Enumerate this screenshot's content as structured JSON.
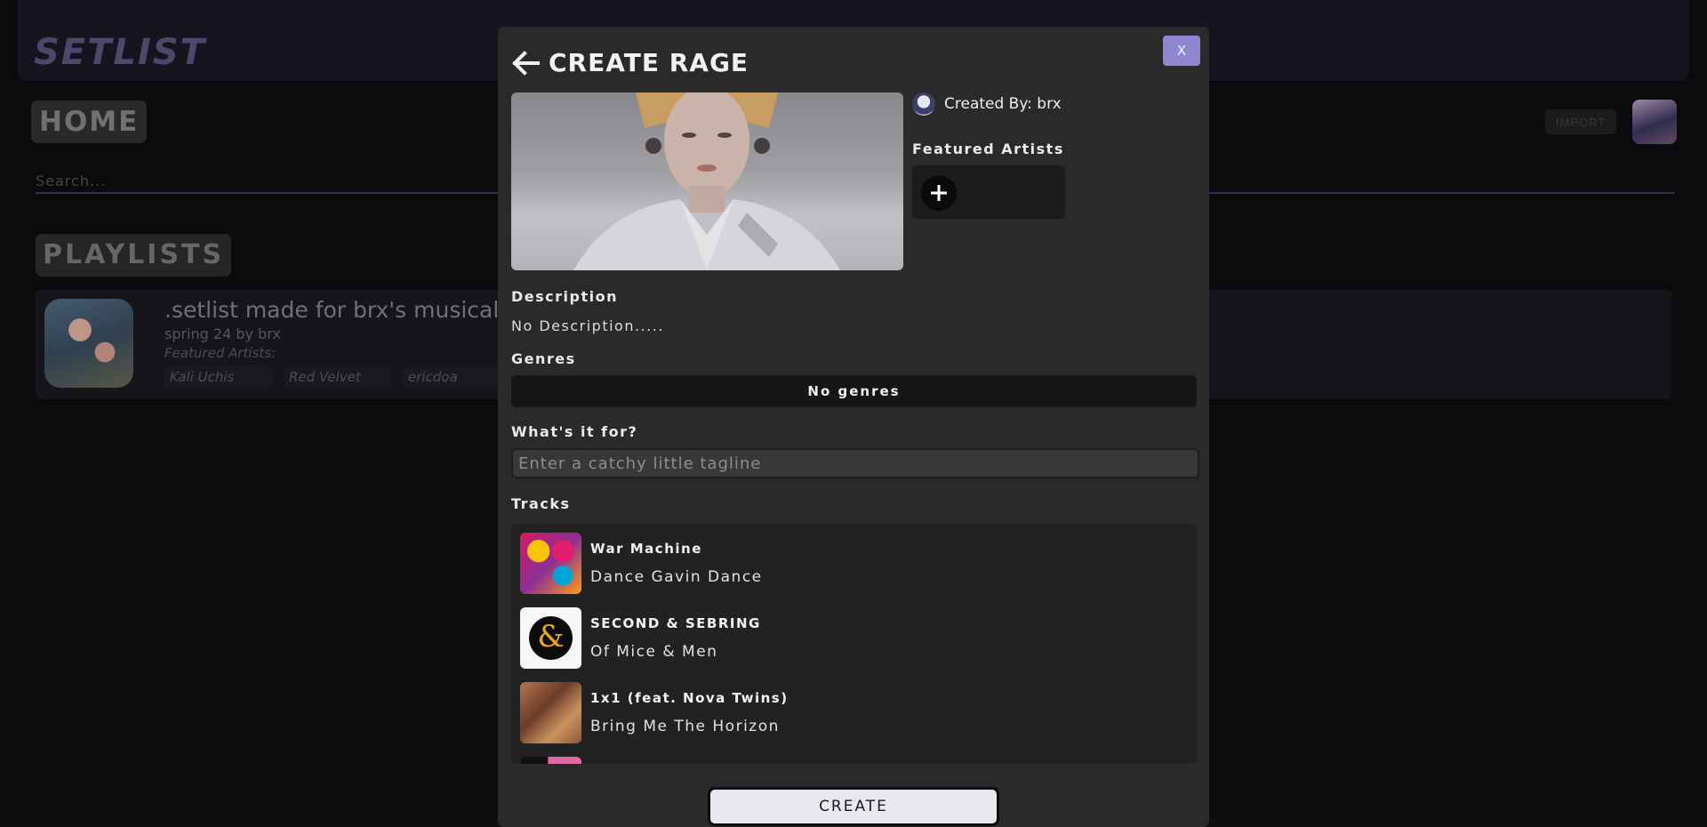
{
  "app": {
    "brand": "SETLIST"
  },
  "nav": {
    "home_label": "HOME",
    "import_label": "IMPORT"
  },
  "search": {
    "placeholder": "Search..."
  },
  "playlists": {
    "heading": "PLAYLISTS",
    "items": [
      {
        "title": ".setlist made for brx's musical",
        "subtitle": "spring 24 by brx",
        "featured_label": "Featured Artists:",
        "artists": [
          "Kali Uchis",
          "Red Velvet",
          "ericdoa"
        ]
      }
    ]
  },
  "modal": {
    "title": "CREATE RAGE",
    "close_label": "X",
    "created_by": "Created By: brx",
    "featured_artists_heading": "Featured Artists",
    "description_heading": "Description",
    "description_text": "No Description.....",
    "genres_heading": "Genres",
    "genres_empty": "No genres",
    "purpose_heading": "What's it for?",
    "tagline_placeholder": "Enter a catchy little tagline",
    "tracks_heading": "Tracks",
    "tracks": [
      {
        "title": "War Machine",
        "artist": "Dance Gavin Dance"
      },
      {
        "title": "SECOND & SEBRING",
        "artist": "Of Mice & Men"
      },
      {
        "title": "1x1 (feat. Nova Twins)",
        "artist": "Bring Me The Horizon"
      },
      {
        "title": "",
        "artist": ""
      }
    ],
    "create_label": "CREATE"
  },
  "icons": {
    "back": "arrow-left-icon",
    "add": "plus-icon",
    "close": "x-label"
  },
  "colors": {
    "accent": "#8f86d0",
    "brand": "#5f5784",
    "modal_bg": "#2a2a2a"
  }
}
